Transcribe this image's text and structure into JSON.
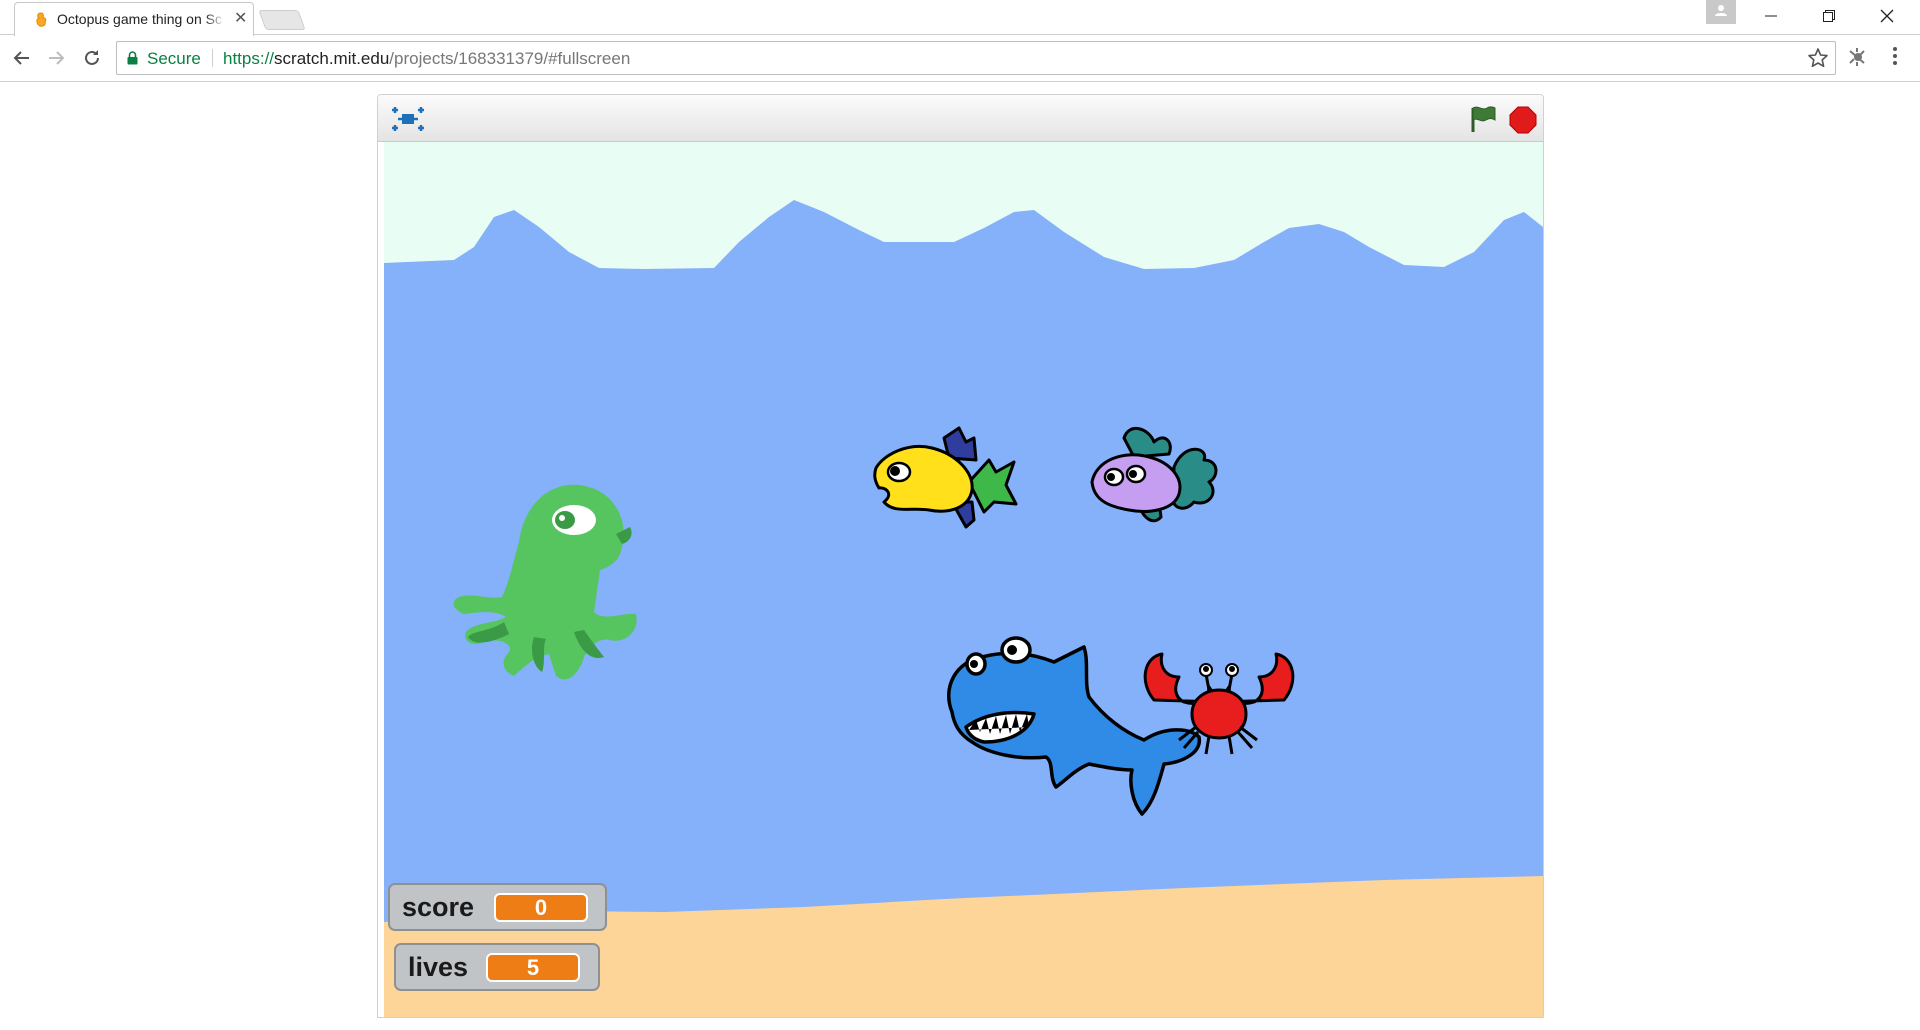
{
  "browser": {
    "tab": {
      "title": "Octopus game thing on Scratch"
    },
    "close_tab_glyph": "✕",
    "address": {
      "secure_label": "Secure",
      "url_scheme": "https://",
      "url_host": "scratch.mit.edu",
      "url_path": "/projects/168331379/#fullscreen"
    },
    "icons": [
      "scratch-favicon",
      "back-arrow-icon",
      "forward-arrow-icon",
      "reload-icon",
      "lock-icon",
      "star-icon",
      "extension-icon",
      "menu-icon",
      "minimize-icon",
      "restore-icon",
      "close-icon",
      "profile-icon"
    ]
  },
  "player": {
    "icons": [
      "fullscreen-toggle-icon",
      "green-flag-icon",
      "stop-icon"
    ],
    "stage": {
      "colors": {
        "sky": "#e8fdf4",
        "water": "#85b0fa",
        "sand": "#fed598"
      },
      "sprites": [
        "octopus",
        "yellow-fish",
        "purple-fish",
        "shark",
        "crab"
      ]
    },
    "monitors": {
      "score": {
        "label": "score",
        "value": "0"
      },
      "lives": {
        "label": "lives",
        "value": "5"
      }
    }
  }
}
